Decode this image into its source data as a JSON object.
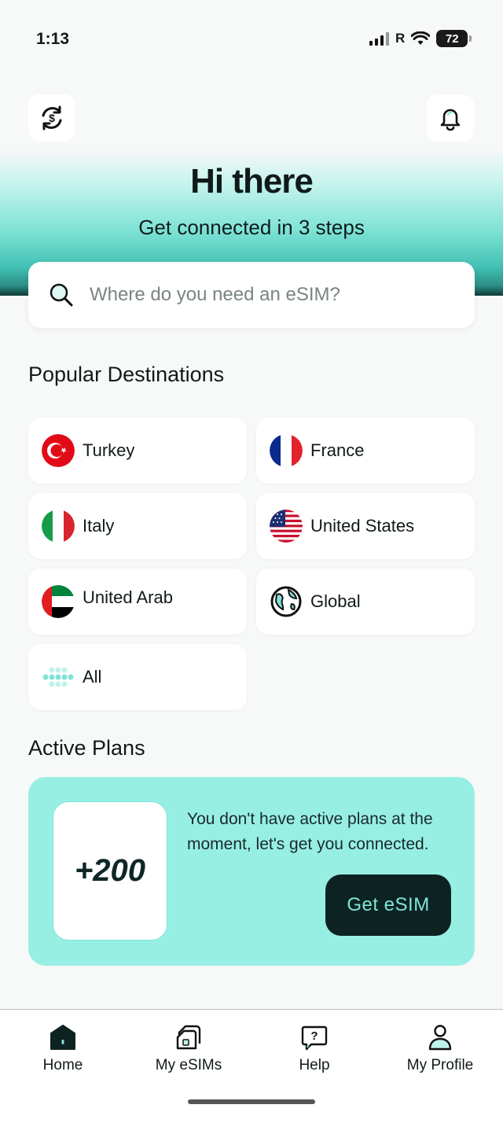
{
  "status": {
    "time": "1:13",
    "carrier": "R",
    "battery": "72"
  },
  "header": {
    "currency_icon": "currency-exchange-icon",
    "notification_icon": "bell-icon",
    "greeting": "Hi there",
    "subtitle": "Get connected in 3 steps"
  },
  "search": {
    "placeholder": "Where do you need an eSIM?",
    "value": ""
  },
  "popular": {
    "title": "Popular Destinations",
    "items": [
      {
        "label": "Turkey",
        "icon": "turkey-flag-icon"
      },
      {
        "label": "France",
        "icon": "france-flag-icon"
      },
      {
        "label": "Italy",
        "icon": "italy-flag-icon"
      },
      {
        "label": "United States",
        "icon": "us-flag-icon"
      },
      {
        "label": "United Arab",
        "icon": "uae-flag-icon"
      },
      {
        "label": "Global",
        "icon": "globe-icon"
      },
      {
        "label": "All",
        "icon": "dots-grid-icon"
      }
    ]
  },
  "active_plans": {
    "title": "Active Plans",
    "badge": "+200",
    "message": "You don't have active plans at the moment, let's get you connected.",
    "button": "Get eSIM"
  },
  "nav": {
    "items": [
      {
        "label": "Home",
        "icon": "home-icon"
      },
      {
        "label": "My eSIMs",
        "icon": "sim-card-icon"
      },
      {
        "label": "Help",
        "icon": "help-chat-icon"
      },
      {
        "label": "My Profile",
        "icon": "profile-icon"
      }
    ]
  },
  "colors": {
    "accent": "#97efe4",
    "dark_button": "#0d2322",
    "button_text": "#7fe7d9"
  }
}
